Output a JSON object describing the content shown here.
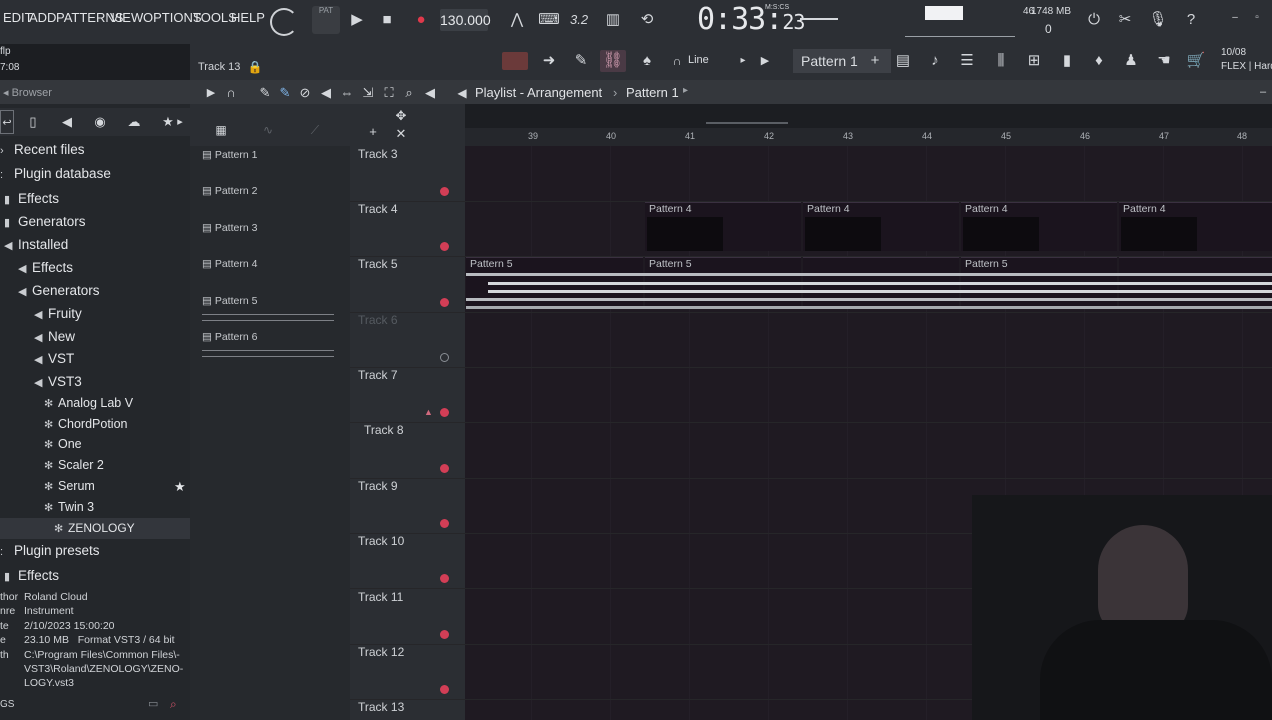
{
  "menu": [
    "EDIT",
    "ADD",
    "PATTERNS",
    "VIEW",
    "OPTIONS",
    "TOOLS",
    "HELP"
  ],
  "file_snippet": [
    "flp",
    "7:08"
  ],
  "transport": {
    "pat_label": "PAT",
    "bpm": "130.000",
    "time": "0:33",
    "time_frac": "23",
    "time_units": "M:S:CS",
    "step_label": "3.2"
  },
  "cpu": {
    "value": "46",
    "memory": "1748 MB",
    "voices": "0"
  },
  "date_block": {
    "date": "10/08",
    "label": "FLEX | Hard"
  },
  "channel_hint": "Track 13",
  "snap": {
    "label": "Line"
  },
  "pattern_selector": "Pattern 1",
  "playlist": {
    "title": "Playlist - Arrangement",
    "pattern": "Pattern 1"
  },
  "browser": {
    "title": "Browser",
    "tree": [
      {
        "label": "Recent files",
        "level": 0
      },
      {
        "label": "Plugin database",
        "level": 0
      },
      {
        "label": "Effects",
        "level": 0
      },
      {
        "label": "Generators",
        "level": 0
      },
      {
        "label": "Installed",
        "level": 0
      },
      {
        "label": "Effects",
        "level": 1
      },
      {
        "label": "Generators",
        "level": 1
      },
      {
        "label": "Fruity",
        "level": 2
      },
      {
        "label": "New",
        "level": 2
      },
      {
        "label": "VST",
        "level": 2
      },
      {
        "label": "VST3",
        "level": 2
      },
      {
        "label": "Analog Lab V",
        "level": 3
      },
      {
        "label": "ChordPotion",
        "level": 3
      },
      {
        "label": "One",
        "level": 3
      },
      {
        "label": "Scaler 2",
        "level": 3
      },
      {
        "label": "Serum",
        "level": 3
      },
      {
        "label": "Twin 3",
        "level": 3
      },
      {
        "label": "ZENOLOGY",
        "level": 4
      },
      {
        "label": "Plugin presets",
        "level": 0
      },
      {
        "label": "Effects",
        "level": 0
      }
    ],
    "info": {
      "author_k": "thor",
      "author_v": "Roland Cloud",
      "genre_k": "nre",
      "genre_v": "Instrument",
      "date_k": "te",
      "date_v": "2/10/2023 15:00:20",
      "size_k": "e",
      "size_v": "23.10 MB",
      "format_k": "Format",
      "format_v": "VST3 / 64 bit",
      "path_k": "th",
      "path_v": "C:\\Program Files\\Common Files\\-VST3\\Roland\\ZENOLOGY\\ZENO-LOGY.vst3",
      "footer": "GS"
    }
  },
  "picker": [
    "Pattern 1",
    "Pattern 2",
    "Pattern 3",
    "Pattern 4",
    "Pattern 5",
    "Pattern 6"
  ],
  "tracks": [
    "Track 3",
    "Track 4",
    "Track 5",
    "Track 6",
    "Track 7",
    "Track 8",
    "Track 9",
    "Track 10",
    "Track 11",
    "Track 12",
    "Track 13"
  ],
  "ruler": [
    "39",
    "40",
    "41",
    "42",
    "43",
    "44",
    "45",
    "46",
    "47",
    "48"
  ],
  "clips": {
    "p4": "Pattern 4",
    "p5": "Pattern 5"
  }
}
